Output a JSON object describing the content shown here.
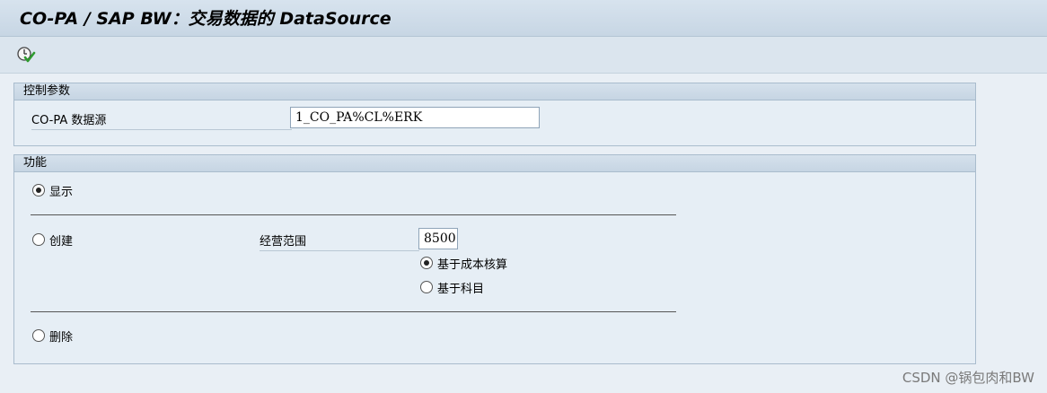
{
  "window": {
    "title": "CO-PA / SAP BW：交易数据的 DataSource"
  },
  "toolbar": {
    "execute_icon": "execute-clock-check-icon"
  },
  "control_params": {
    "header": "控制参数",
    "datasource_label": "CO-PA 数据源",
    "datasource_value": "1_CO_PA%CL%ERK"
  },
  "functions": {
    "header": "功能",
    "display_label": "显示",
    "display_selected": true,
    "create_label": "创建",
    "create_selected": false,
    "operating_concern_label": "经营范围",
    "operating_concern_value": "8500",
    "costing_based_label": "基于成本核算",
    "costing_based_selected": true,
    "account_based_label": "基于科目",
    "account_based_selected": false,
    "delete_label": "删除",
    "delete_selected": false
  },
  "watermark": "CSDN @锅包肉和BW"
}
